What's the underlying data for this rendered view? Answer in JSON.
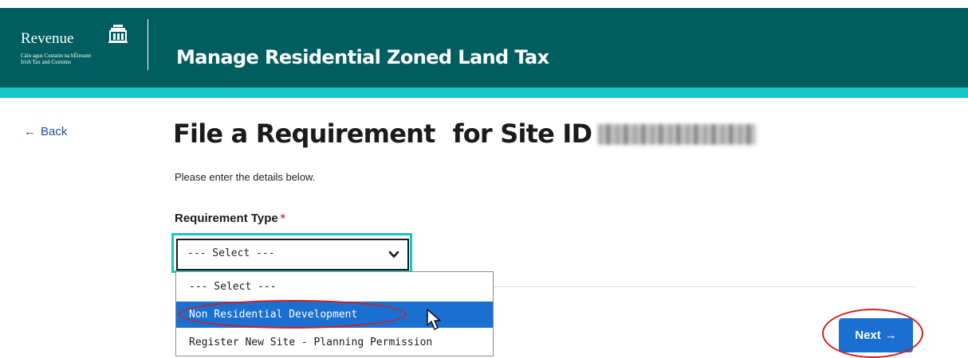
{
  "header": {
    "logo_word": "Revenue",
    "logo_sub_1": "Cáin agus Custaim na hÉireann",
    "logo_sub_2": "Irish Tax and Customs",
    "title": "Manage Residential Zoned Land Tax"
  },
  "nav": {
    "back_arrow": "←",
    "back_label": "Back"
  },
  "page": {
    "title_part1": "File a Requirement",
    "title_part2": "for Site ID",
    "intro": "Please enter the details below."
  },
  "form": {
    "requirement_type_label": "Requirement Type",
    "required_marker": "*",
    "selected_value": "--- Select ---",
    "options": [
      "--- Select ---",
      "Non Residential Development",
      "Register New Site - Planning Permission"
    ],
    "highlighted_option_index": 1
  },
  "actions": {
    "next_label": "Next",
    "next_arrow": "→"
  },
  "colors": {
    "header_bg": "#005e61",
    "accent_bar": "#16c7c7",
    "primary_button": "#1a6fd0",
    "annotation_red": "#d21f1f"
  },
  "icons": {
    "logo": "revenue-harp-crest-icon",
    "select_chevron": "chevron-down-icon",
    "pointer": "mouse-cursor-icon"
  }
}
